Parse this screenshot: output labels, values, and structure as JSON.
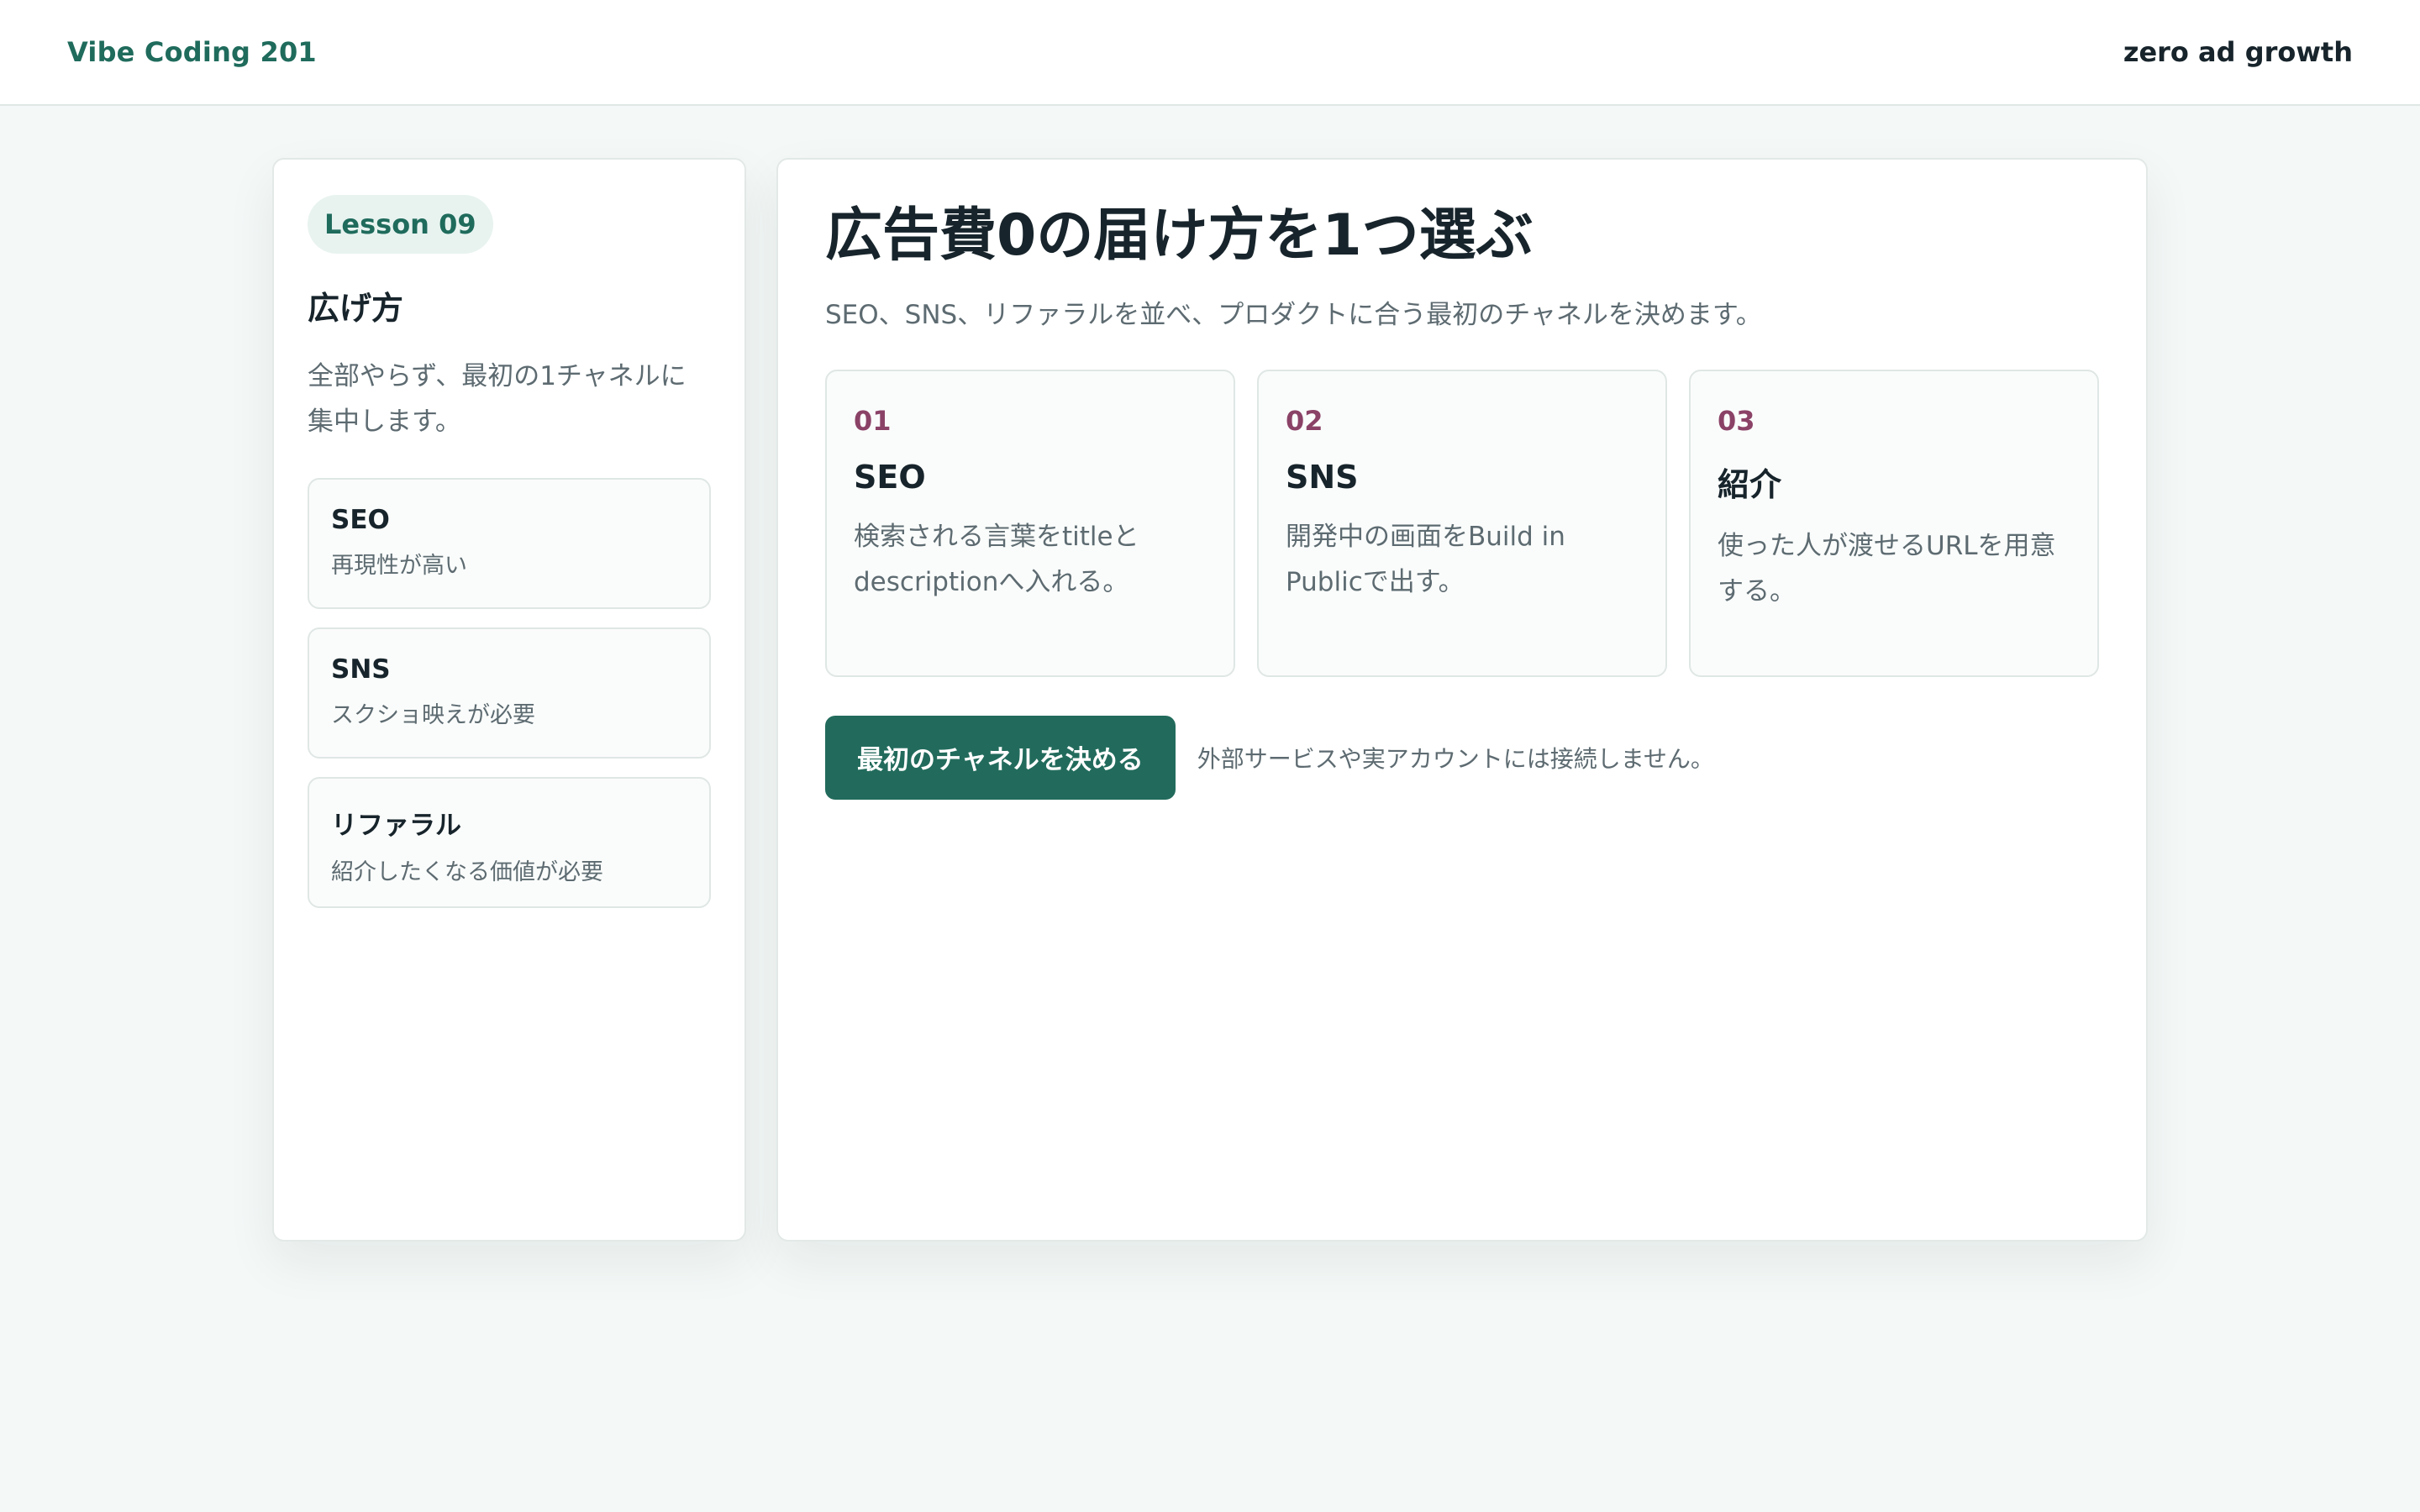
{
  "header": {
    "brand": "Vibe Coding 201",
    "right_label": "zero ad growth"
  },
  "sidebar": {
    "badge": "Lesson 09",
    "title": "広げ方",
    "description": "全部やらず、最初の1チャネルに集中します。",
    "items": [
      {
        "title": "SEO",
        "subtitle": "再現性が高い"
      },
      {
        "title": "SNS",
        "subtitle": "スクショ映えが必要"
      },
      {
        "title": "リファラル",
        "subtitle": "紹介したくなる価値が必要"
      }
    ]
  },
  "main": {
    "title": "広告費0の届け方を1つ選ぶ",
    "description": "SEO、SNS、リファラルを並べ、プロダクトに合う最初のチャネルを決めます。",
    "cards": [
      {
        "num": "01",
        "title": "SEO",
        "body": "検索される言葉をtitleとdescriptionへ入れる。"
      },
      {
        "num": "02",
        "title": "SNS",
        "body": "開発中の画面をBuild in Publicで出す。"
      },
      {
        "num": "03",
        "title": "紹介",
        "body": "使った人が渡せるURLを用意する。"
      }
    ],
    "primary_button": "最初のチャネルを決める",
    "note": "外部サービスや実アカウントには接続しません。"
  }
}
